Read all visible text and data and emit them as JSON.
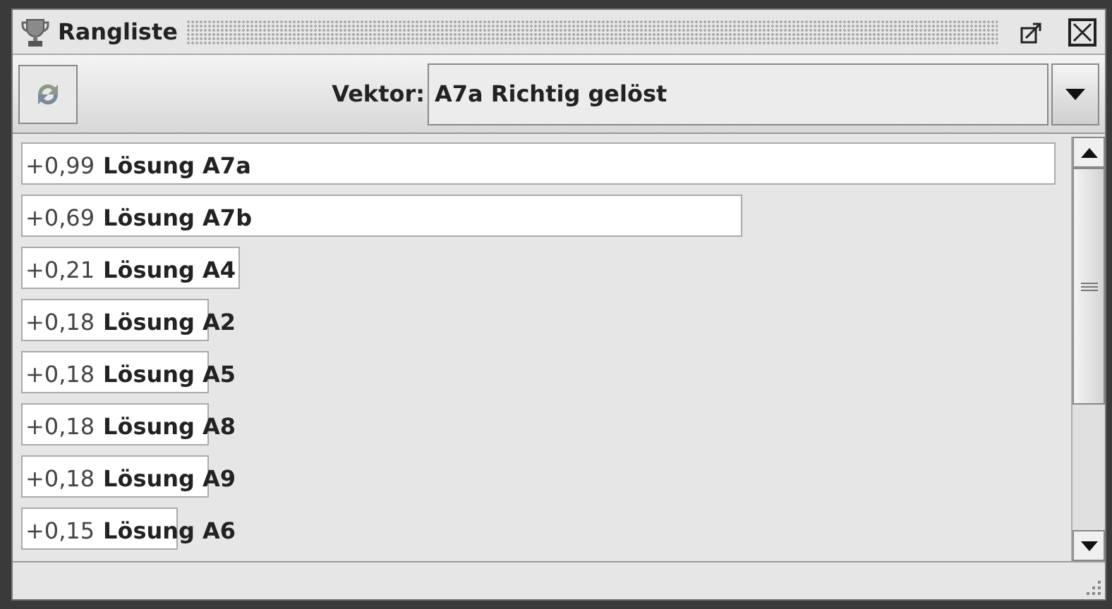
{
  "window": {
    "title": "Rangliste"
  },
  "toolbar": {
    "vector_label": "Vektor:",
    "vector_value": "A7a Richtig gelöst"
  },
  "ranking": [
    {
      "score": "+0,99",
      "name": "Lösung A7a",
      "level": 0.99
    },
    {
      "score": "+0,69",
      "name": "Lösung A7b",
      "level": 0.69
    },
    {
      "score": "+0,21",
      "name": "Lösung A4",
      "level": 0.21
    },
    {
      "score": "+0,18",
      "name": "Lösung A2",
      "level": 0.18
    },
    {
      "score": "+0,18",
      "name": "Lösung A5",
      "level": 0.18
    },
    {
      "score": "+0,18",
      "name": "Lösung A8",
      "level": 0.18
    },
    {
      "score": "+0,18",
      "name": "Lösung A9",
      "level": 0.18
    },
    {
      "score": "+0,15",
      "name": "Lösung A6",
      "level": 0.15
    }
  ]
}
